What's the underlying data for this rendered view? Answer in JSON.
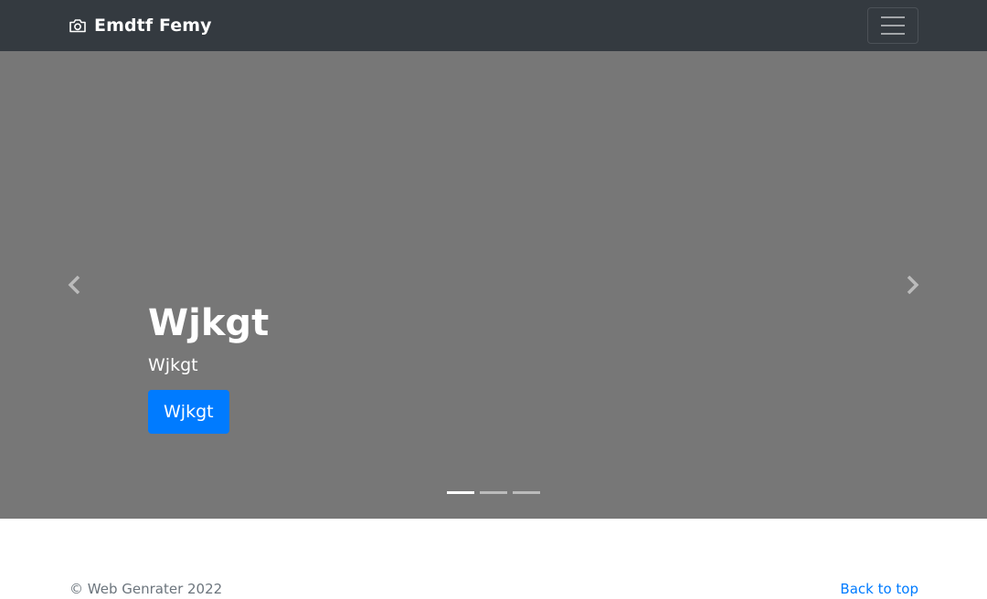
{
  "navbar": {
    "brand": "Emdtf Femy",
    "brand_icon": "camera-icon",
    "toggler_icon": "hamburger-icon",
    "background": "#343a40"
  },
  "carousel": {
    "background": "#777777",
    "prev_icon": "chevron-left-icon",
    "next_icon": "chevron-right-icon",
    "caption": {
      "title": "Wjkgt",
      "subtitle": "Wjkgt",
      "button_label": "Wjkgt",
      "button_color": "#007bff"
    },
    "indicators": {
      "count": 3,
      "active_index": 0
    }
  },
  "footer": {
    "copyright": "© Web Genrater 2022",
    "back_to_top": "Back to top",
    "link_color": "#007bff"
  }
}
